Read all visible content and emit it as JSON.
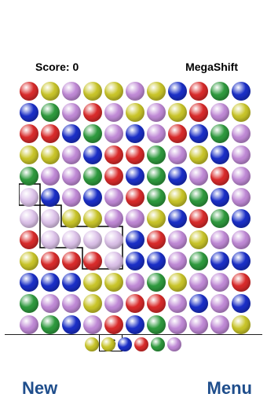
{
  "header": {
    "score_text": "Score: 0",
    "title": "MegaShift"
  },
  "palette": {
    "R": "#d92b2b",
    "G": "#2f9a3e",
    "B": "#1b2fc7",
    "Y": "#c9c52a",
    "P": "#c08ad6",
    "S": "#ddc3ea"
  },
  "board": {
    "rows": [
      "RYPYYPYBRGB",
      "BGPRPYPYRPY",
      "RRBGPBPRBGP",
      "YYPBRRGPYBP",
      "GPPGRBGBPRP",
      "SBPBPRGYGBP",
      "SSYYPPYBRGB",
      "RSSSSBRPYPP",
      "YRRRSBBPGBB",
      "BBBYYPGYPPR",
      "GPPYPRRPBPB",
      "PGBPRBGPPPY"
    ],
    "selection_count": "56"
  },
  "next_balls": [
    "Y",
    "Y",
    "B",
    "R",
    "G",
    "P"
  ],
  "footer": {
    "new_label": "New",
    "menu_label": "Menu"
  }
}
